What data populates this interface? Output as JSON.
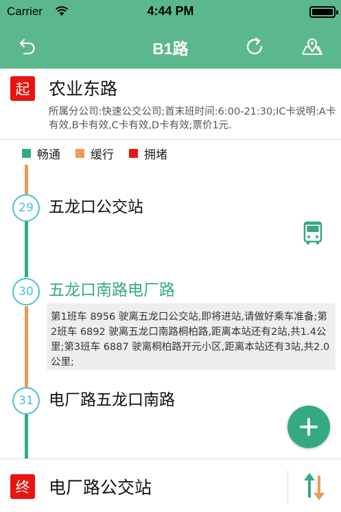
{
  "status_bar": {
    "carrier": "Carrier",
    "time": "4:44 PM",
    "battery_level": 1.0
  },
  "nav": {
    "title": "B1路",
    "icons": [
      "back-arrow-icon",
      "refresh-icon",
      "map-pin-icon"
    ]
  },
  "start": {
    "badge": "起",
    "name": "农业东路",
    "info": "所属分公司:快速公交公司;首末班时间:6:00-21:30;IC卡说明:A卡有效,B卡有效,C卡有效,D卡有效;票价1元."
  },
  "legend": [
    {
      "label": "畅通",
      "color": "#35a984"
    },
    {
      "label": "缓行",
      "color": "#ef9a55"
    },
    {
      "label": "拥堵",
      "color": "#e8140f"
    }
  ],
  "stops": [
    {
      "number": "29",
      "name": "五龙口公交站",
      "current": false
    },
    {
      "number": "30",
      "name": "五龙口南路电厂路",
      "current": true
    },
    {
      "number": "31",
      "name": "电厂路五龙口南路",
      "current": false
    }
  ],
  "bus_info": "第1班车 8956 驶离五龙口公交站,即将进站,请做好乘车准备;第2班车 6892 驶离五龙口南路桐柏路,距离本站还有2站,共1.4公里;第3班车 6887 驶离桐柏路开元小区,距离本站还有3站,共2.0公里;",
  "end": {
    "badge": "终",
    "name": "电厂路公交站"
  },
  "colors": {
    "primary": "#5bb88d",
    "green": "#35a984",
    "orange": "#ef9a55",
    "red": "#e8140f",
    "stop_ring": "#46c3d3"
  }
}
